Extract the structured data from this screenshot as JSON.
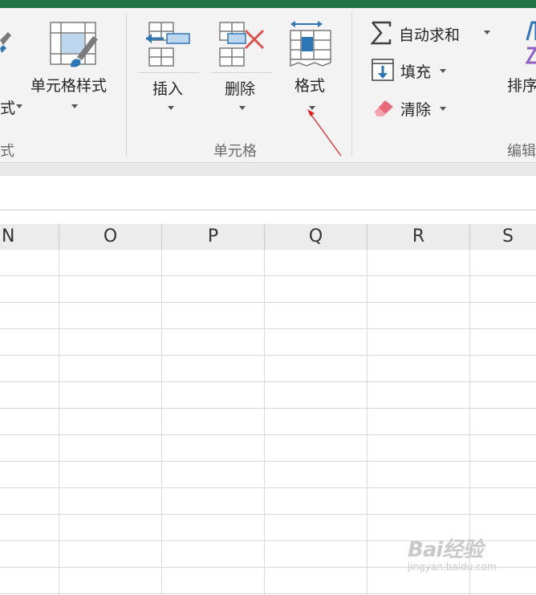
{
  "ribbon": {
    "styles_group": {
      "cell_styles_label": "单元格样式",
      "partial_label_left": "式",
      "partial_group_label": "式"
    },
    "cells_group": {
      "label": "单元格",
      "insert_label": "插入",
      "delete_label": "删除",
      "format_label": "格式"
    },
    "editing_group": {
      "label": "编辑",
      "autosum_label": "自动求和",
      "fill_label": "填充",
      "clear_label": "清除",
      "sort_label": "排序"
    }
  },
  "columns": [
    "N",
    "O",
    "P",
    "Q",
    "R",
    "S"
  ],
  "annotation": {
    "arrow_color": "#e02020"
  },
  "watermark": {
    "brand": "Bai经验",
    "url": "jingyan.baidu.com"
  },
  "colors": {
    "excel_green": "#217346",
    "icon_blue": "#2e75b6",
    "delete_red": "#d9534f",
    "eraser_pink": "#e86a7a"
  }
}
